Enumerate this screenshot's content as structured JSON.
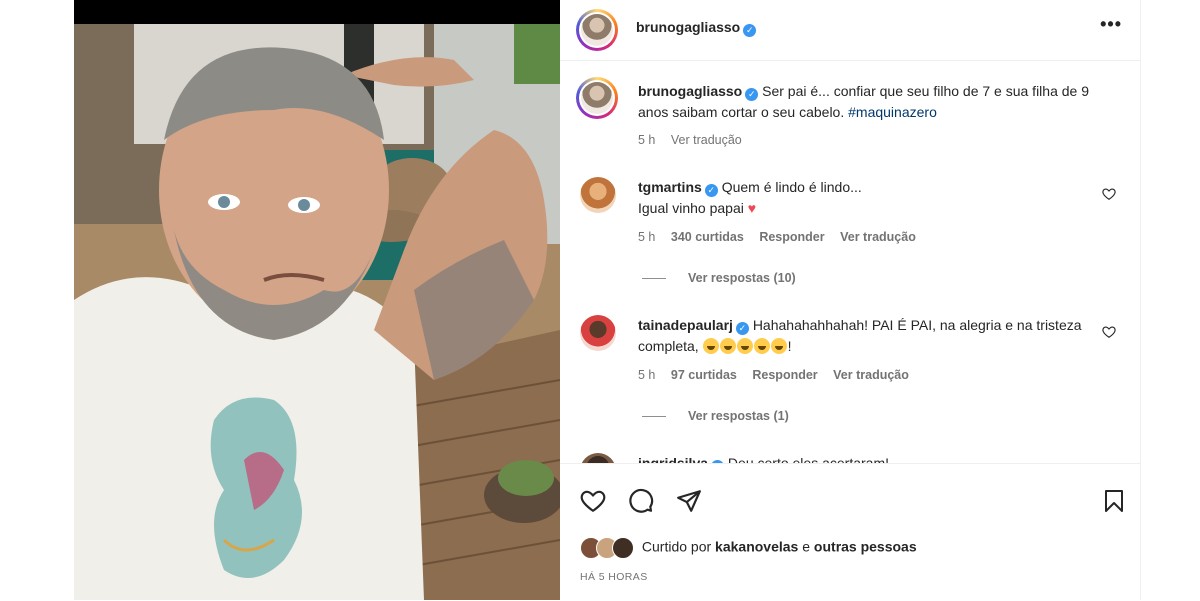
{
  "post": {
    "author": "brunogagliasso",
    "more_icon": "more-horizontal-icon"
  },
  "caption": {
    "username": "brunogagliasso",
    "text": "Ser pai é... confiar que seu filho de 7 e sua filha de 9 anos saibam cortar o seu cabelo.",
    "hashtag": "#maquinazero",
    "time": "5 h",
    "translate": "Ver tradução"
  },
  "comments": [
    {
      "username": "tgmartins",
      "text": "Quem é lindo é lindo...",
      "text_line2": "Igual vinho papai",
      "time": "5 h",
      "likes": "340 curtidas",
      "reply": "Responder",
      "translate": "Ver tradução",
      "view_replies": "Ver respostas (10)"
    },
    {
      "username": "tainadepaularj",
      "text": "Hahahahahhahah! PAI É PAI, na alegria e na tristeza completa,",
      "text_tail": "!",
      "time": "5 h",
      "likes": "97 curtidas",
      "reply": "Responder",
      "translate": "Ver tradução",
      "view_replies": "Ver respostas (1)"
    },
    {
      "username": "ingridsilva",
      "text": "Deu certo eles acertaram!"
    }
  ],
  "footer": {
    "liked_prefix": "Curtido por",
    "liked_user": "kakanovelas",
    "liked_suffix": "e",
    "liked_others": "outras pessoas",
    "timestamp": "HÁ 5 HORAS"
  },
  "colors": {
    "verified": "#3897f0",
    "hashtag": "#00376b",
    "heart_emoji": "#ed4956"
  }
}
